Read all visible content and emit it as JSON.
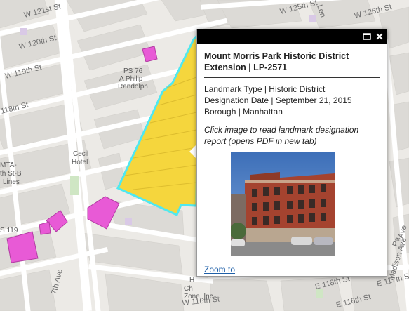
{
  "map": {
    "street_labels": [
      "W 121st St",
      "W 120th St",
      "W 119th St",
      "118th St",
      "W 125th St",
      "W 126th St",
      "Len",
      "7th Ave",
      "Madison Ave",
      "W 116th St",
      "E 118th St",
      "E 116th St",
      "E 117th St",
      "Pa",
      "Ave"
    ],
    "place_labels": {
      "ps76_line1": "PS 76",
      "ps76_line2": "A Philip",
      "ps76_line3": "Randolph",
      "cecil_line1": "Cecil",
      "cecil_line2": "Hotel",
      "mta_line1": "MTA-",
      "mta_line2": "th St-B",
      "mta_line3": "Lines",
      "ps119": "S 119",
      "church_line1": "H",
      "church_line2": "Ch",
      "church_line3": "Zone, Inc."
    },
    "colors": {
      "district_fill": "#f5d63d",
      "district_outline": "#4fe8f0",
      "landmark_fill": "#e85ad6",
      "block_fill": "#dcdad6",
      "street": "#ffffff"
    }
  },
  "popup": {
    "title": "Mount Morris Park Historic District Extension | LP-2571",
    "attributes": [
      "Landmark Type | Historic District",
      "Designation Date | September 21, 2015",
      "Borough | Manhattan"
    ],
    "note": "Click image to read landmark designation report (opens PDF in new tab)",
    "zoom_label": "Zoom to",
    "maximize_icon": "maximize-icon",
    "close_icon": "close-icon"
  }
}
